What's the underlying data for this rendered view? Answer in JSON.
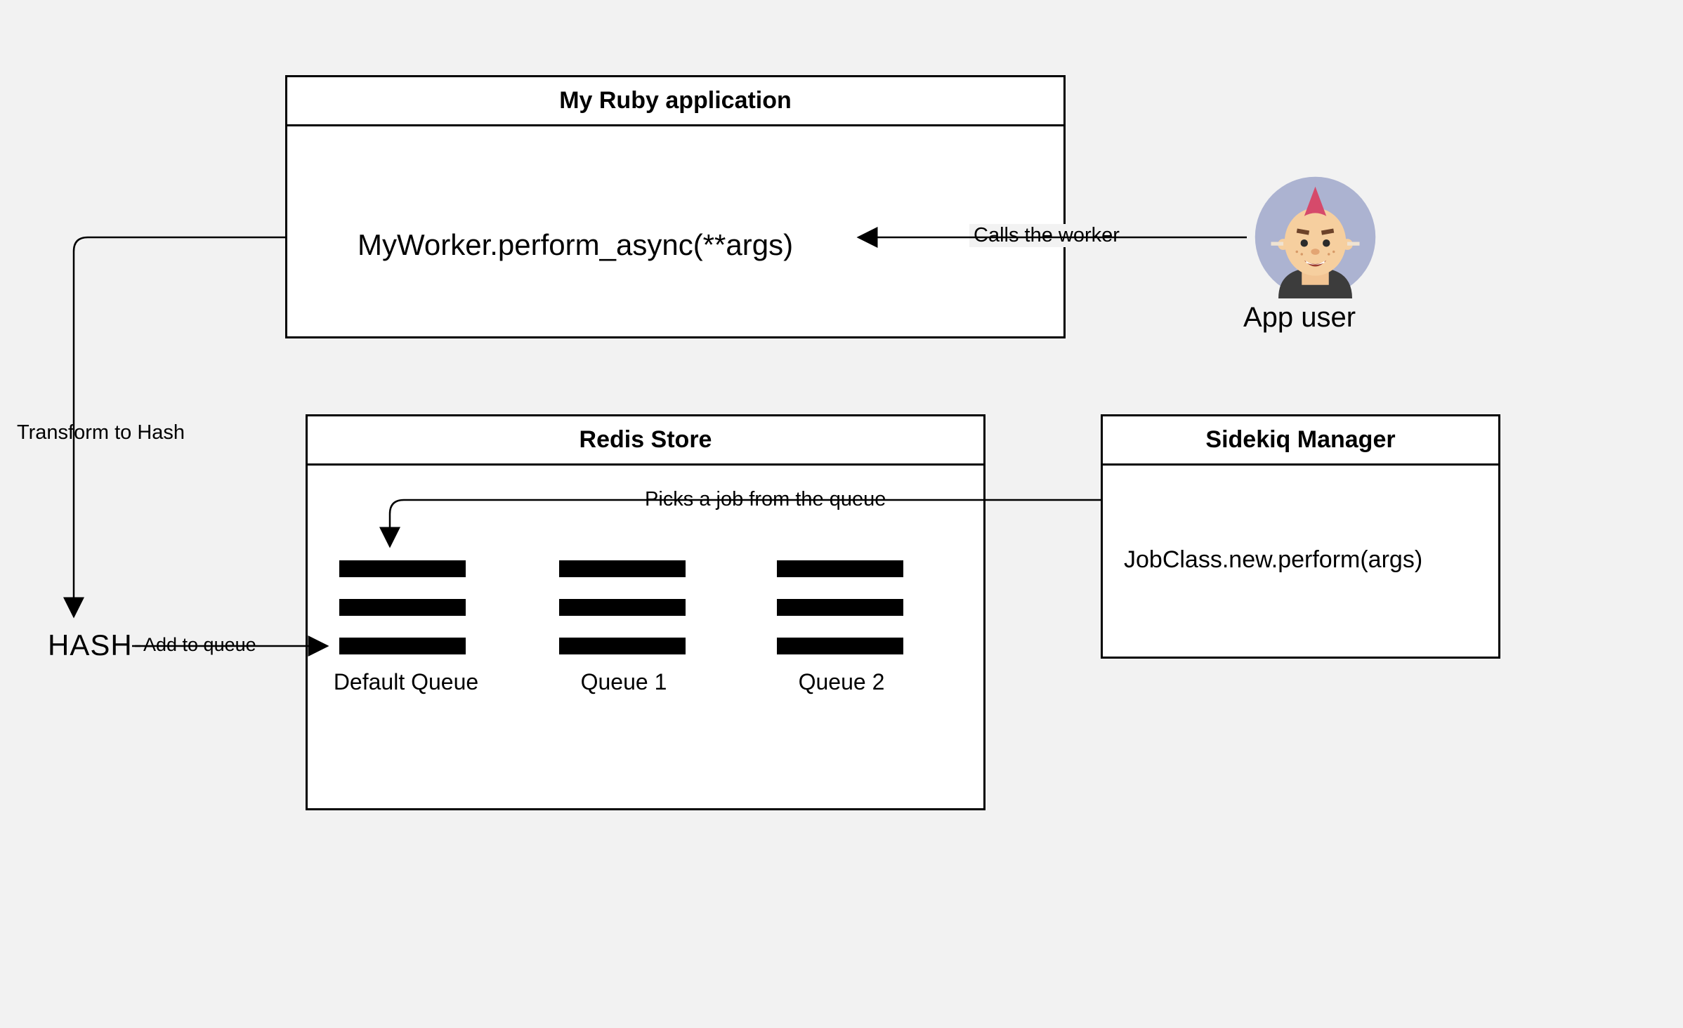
{
  "app_box": {
    "title": "My Ruby application",
    "code_line": "MyWorker.perform_async(**args)"
  },
  "redis_box": {
    "title": "Redis Store",
    "queues": [
      "Default Queue",
      "Queue 1",
      "Queue 2"
    ]
  },
  "sidekiq_box": {
    "title": "Sidekiq Manager",
    "code_line": "JobClass.new.perform(args)"
  },
  "user_label": "App user",
  "hash_label": "HASH",
  "edge_labels": {
    "calls_worker": "Calls the worker",
    "transform": "Transform to Hash",
    "add_to_queue": "Add to queue",
    "picks_job": "Picks a job from the queue"
  }
}
